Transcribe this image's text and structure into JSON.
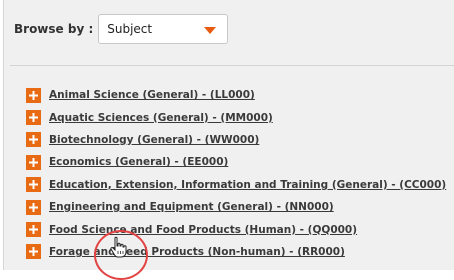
{
  "browse": {
    "label": "Browse by :",
    "selected": "Subject"
  },
  "subjects": [
    "Animal Science (General) - (LL000)",
    "Aquatic Sciences (General) - (MM000)",
    "Biotechnology (General) - (WW000)",
    "Economics (General) - (EE000)",
    "Education, Extension, Information and Training (General) - (CC000)",
    "Engineering and Equipment (General) - (NN000)",
    "Food Science and Food Products (Human) - (QQ000)",
    "Forage and Feed Products (Non-human) - (RR000)"
  ],
  "colors": {
    "accent": "#e86a12",
    "highlight_ring": "#e24444",
    "link_text": "#3a3a3a",
    "panel_bg": "#f0f0f0"
  },
  "icons": {
    "expand": "plus-icon",
    "dropdown": "caret-down-icon",
    "pointer": "hand-cursor-icon"
  }
}
